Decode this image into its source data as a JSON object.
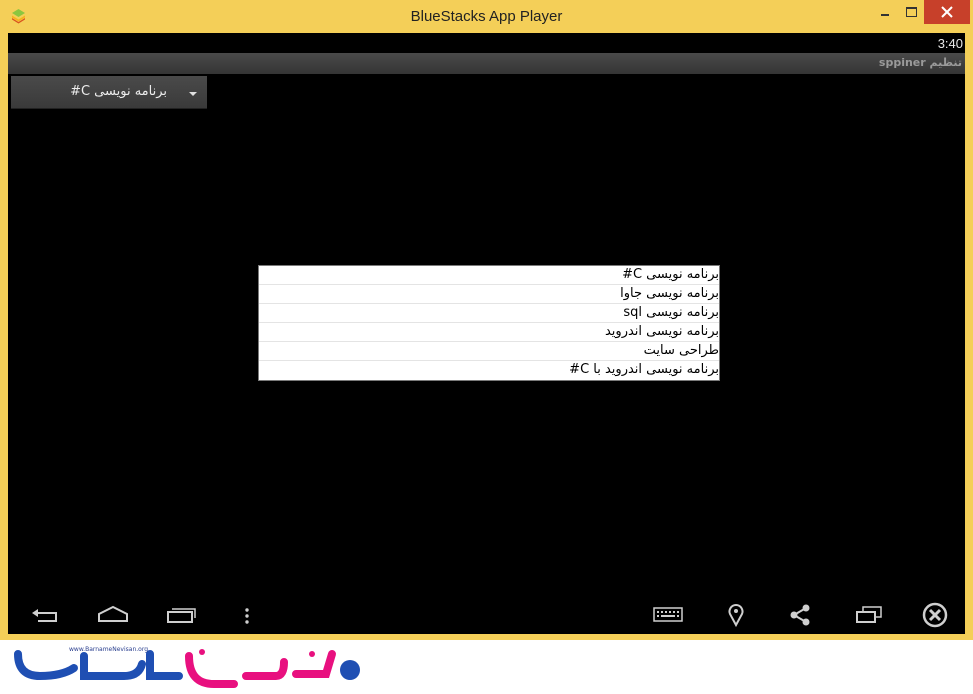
{
  "window": {
    "title": "BlueStacks App Player",
    "accent_color": "#f4cf58",
    "close_color": "#c7402a"
  },
  "statusbar": {
    "time": "3:40"
  },
  "actionbar": {
    "title": "تنظیم sppiner"
  },
  "spinner": {
    "selected": "برنامه نویسی C#"
  },
  "dropdown": {
    "items": [
      "برنامه نویسی C#",
      "برنامه نویسی جاوا",
      "برنامه نویسی sql",
      "برنامه نویسی اندروید",
      "طراحی سایت",
      "برنامه نویسی اندروید با C#"
    ]
  },
  "navbar": {
    "icons": [
      "back-icon",
      "home-icon",
      "recent-apps-icon",
      "menu-dots-icon",
      "keyboard-icon",
      "location-icon",
      "share-icon",
      "screen-rotate-icon",
      "close-app-icon"
    ]
  },
  "watermark": {
    "url": "www.BarnameNevisan.org",
    "logo_text": "برنامه نویسان"
  }
}
